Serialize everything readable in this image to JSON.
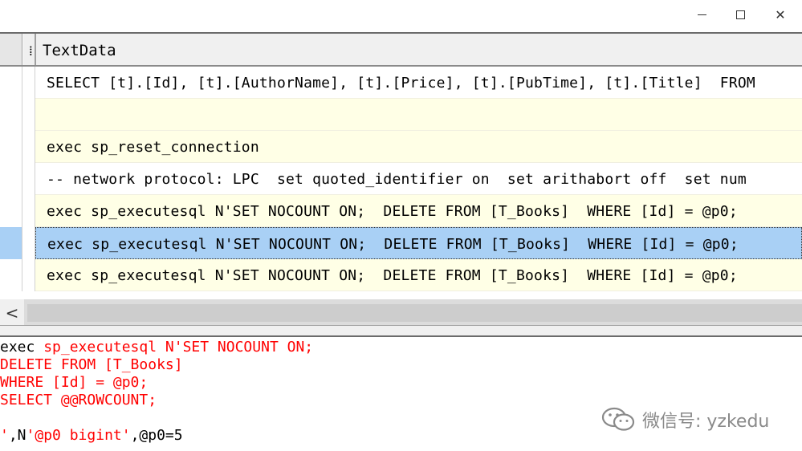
{
  "window": {
    "controls": {
      "minimize": "—",
      "maximize": "☐",
      "close": "✕"
    }
  },
  "grid": {
    "columns": [
      "TextData"
    ],
    "rows": [
      {
        "text": "SELECT [t].[Id], [t].[AuthorName], [t].[Price], [t].[PubTime], [t].[Title]  FROM"
      },
      {
        "text": ""
      },
      {
        "text": "exec sp_reset_connection"
      },
      {
        "text": "-- network protocol: LPC  set quoted_identifier on  set arithabort off  set num"
      },
      {
        "text": "exec sp_executesql N'SET NOCOUNT ON;  DELETE FROM [T_Books]  WHERE [Id] = @p0;"
      },
      {
        "text": "exec sp_executesql N'SET NOCOUNT ON;  DELETE FROM [T_Books]  WHERE [Id] = @p0;"
      },
      {
        "text": "exec sp_executesql N'SET NOCOUNT ON;  DELETE FROM [T_Books]  WHERE [Id] = @p0;"
      }
    ],
    "selected_row_index": 5
  },
  "scrollbar": {
    "left_arrow": "<"
  },
  "detail": {
    "line1_prefix": "exec ",
    "line1_red": "sp_executesql N'SET NOCOUNT ON;",
    "line2": "DELETE FROM [T_Books]",
    "line3": "WHERE [Id] = @p0;",
    "line4": "SELECT @@ROWCOUNT;",
    "line5_red1": "'",
    "line5_blk1": ",N",
    "line5_red2": "'@p0 bigint'",
    "line5_blk2": ",@p0=5"
  },
  "watermark": {
    "icon": "wechat-icon",
    "text": "微信号: yzkedu"
  }
}
